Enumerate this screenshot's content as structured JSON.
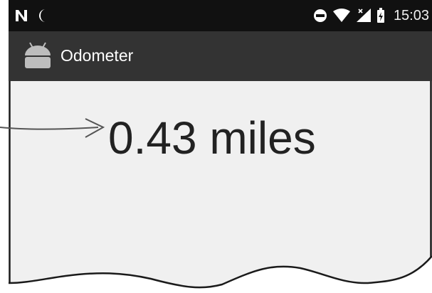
{
  "status_bar": {
    "icons": [
      "n-notification-icon",
      "moon-icon",
      "do-not-disturb-icon",
      "wifi-icon",
      "signal-icon",
      "battery-icon"
    ],
    "time": "15:03"
  },
  "app_bar": {
    "icon": "android-icon",
    "title": "Odometer"
  },
  "main": {
    "distance_text": "0.43 miles"
  },
  "colors": {
    "status_bar": "#111111",
    "action_bar": "#333333",
    "content_bg": "#f0f0f0",
    "text": "#222222"
  }
}
